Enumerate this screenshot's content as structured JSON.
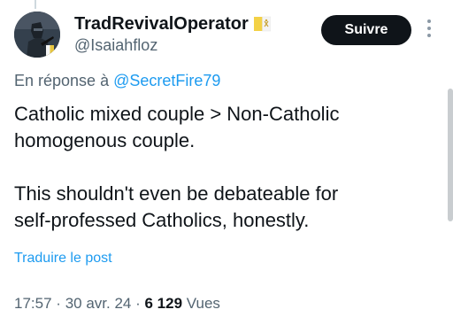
{
  "author": {
    "display_name": "TradRevivalOperator",
    "handle": "@Isaiahfloz",
    "avatar_icon": "avatar-soldier",
    "badge_icon": "vatican-flag-icon"
  },
  "actions": {
    "follow_label": "Suivre",
    "more_icon": "more-vertical-icon"
  },
  "reply": {
    "prefix": "En réponse à",
    "mention": "@SecretFire79"
  },
  "tweet": {
    "paragraph1": "Catholic mixed couple > Non-Catholic\nhomogenous couple.",
    "paragraph2": "This shouldn't even be debateable for\nself-professed Catholics, honestly.",
    "translate_label": "Traduire le post"
  },
  "meta": {
    "time": "17:57",
    "date": "30 avr. 24",
    "views_count": "6 129",
    "views_label": "Vues",
    "separator": "·"
  },
  "colors": {
    "text_primary": "#0f1419",
    "text_secondary": "#536471",
    "link": "#1d9bf0",
    "button_bg": "#0f1419"
  }
}
